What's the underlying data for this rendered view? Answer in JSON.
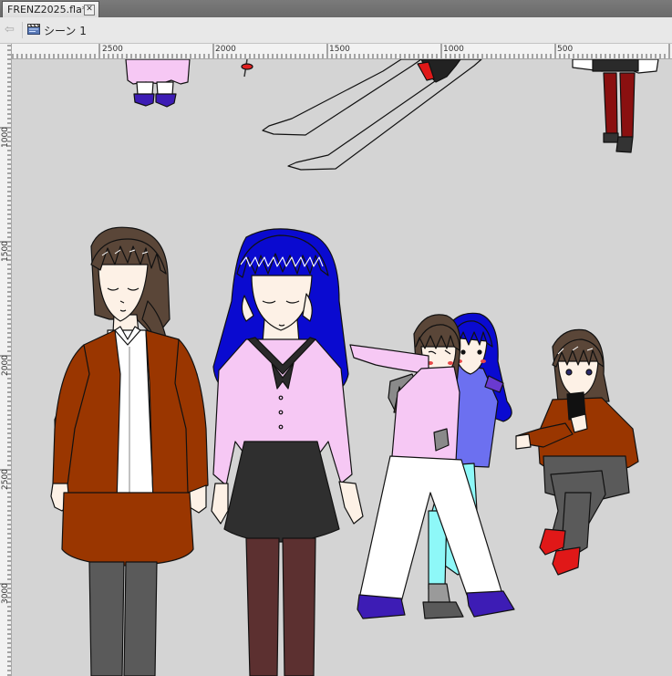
{
  "document_tab": {
    "filename": "FRENZ2025.fla*",
    "close_glyph": "✕"
  },
  "scene_bar": {
    "back_icon": "arrow-left-icon",
    "scene_icon": "clapperboard-icon",
    "scene_label": "シーン 1"
  },
  "rulers": {
    "horizontal_labels": [
      "2500",
      "2000",
      "1500",
      "1000",
      "500"
    ],
    "vertical_labels": [
      "1000",
      "1500",
      "2000",
      "2500",
      "3000"
    ]
  },
  "stage": {
    "background_color": "#d4d4d4",
    "characters": [
      "woman-brown-jacket",
      "woman-blue-hair",
      "two-girls-hugging",
      "girl-sitting-with-phone"
    ]
  },
  "colors": {
    "tabbar": "#6e6e6e",
    "scenebar": "#e8e8e8",
    "ruler": "#f2f2f2",
    "stage": "#d4d4d4",
    "jacket_brown": "#9a3600",
    "hair_blue": "#0a0ad0",
    "blouse_pink": "#f6c8f4",
    "skirt_dark": "#2f2f2f",
    "tights_brown": "#5c3030"
  }
}
